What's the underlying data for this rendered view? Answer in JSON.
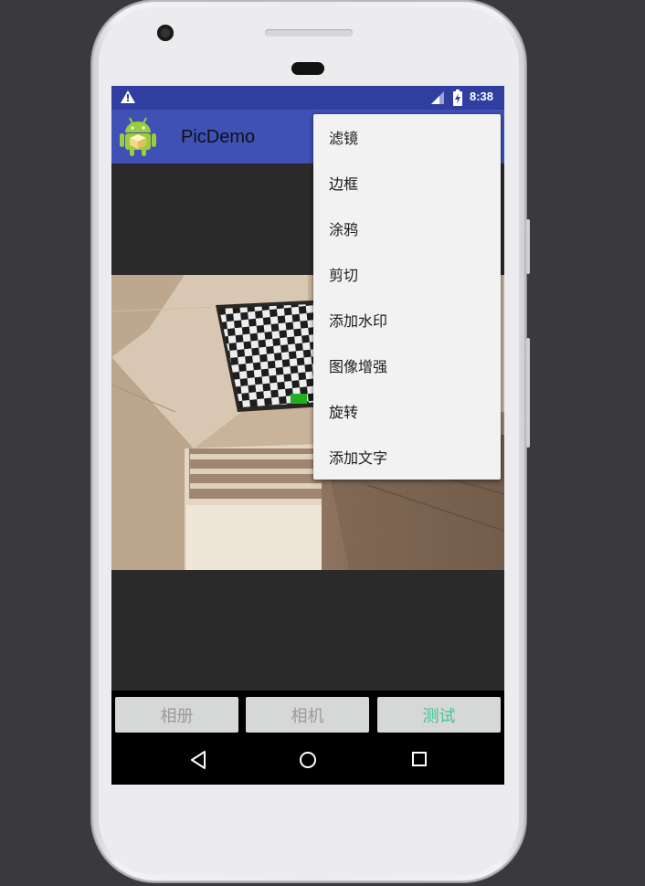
{
  "status_bar": {
    "time": "8:38",
    "icons": [
      "warning-icon",
      "signal-icon",
      "battery-charging-icon"
    ]
  },
  "app_bar": {
    "title": "PicDemo",
    "icon": "android-robot-icon"
  },
  "overflow_menu": {
    "items": [
      {
        "label": "滤镜"
      },
      {
        "label": "边框"
      },
      {
        "label": "涂鸦"
      },
      {
        "label": "剪切"
      },
      {
        "label": "添加水印"
      },
      {
        "label": "图像增强"
      },
      {
        "label": "旋转"
      },
      {
        "label": "添加文字"
      }
    ]
  },
  "buttons": {
    "album": "相册",
    "camera": "相机",
    "test": "测试"
  },
  "colors": {
    "status_bar": "#303f9f",
    "app_bar": "#3f51b5",
    "active_button_text": "#3ec88e",
    "inactive_button_text": "#9b9b9b"
  },
  "navigation": {
    "icons": [
      "back-triangle-icon",
      "home-circle-icon",
      "recents-square-icon"
    ]
  }
}
